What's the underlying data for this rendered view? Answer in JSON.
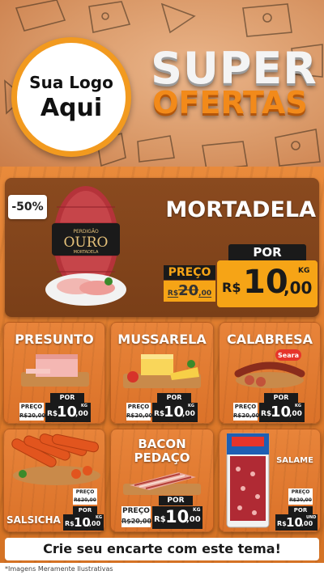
{
  "header": {
    "logo_line1": "Sua Logo",
    "logo_line2": "Aqui",
    "title_line1": "SUPER",
    "title_line2": "OFERTAS"
  },
  "featured": {
    "discount_badge": "-50%",
    "name": "MORTADELA",
    "brand": "OURO",
    "brand_small": "PERDIGÃO",
    "brand_sub": "MORTADELA",
    "preco_label": "PREÇO",
    "old_price_prefix": "R$",
    "old_price": "20",
    "old_price_cents": ",00",
    "por_label": "POR",
    "currency": "R$",
    "price": "10",
    "price_cents": ",00",
    "unit": "KG"
  },
  "products": [
    {
      "name": "PRESUNTO",
      "preco_label": "PREÇO",
      "old_price": "R$20,00",
      "por_label": "POR",
      "currency": "R$",
      "price": "10",
      "price_cents": ",00",
      "unit": "KG"
    },
    {
      "name": "MUSSARELA",
      "preco_label": "PREÇO",
      "old_price": "R$20,00",
      "por_label": "POR",
      "currency": "R$",
      "price": "10",
      "price_cents": ",00",
      "unit": "KG"
    },
    {
      "name": "CALABRESA",
      "brand": "Seara",
      "preco_label": "PREÇO",
      "old_price": "R$20,00",
      "por_label": "POR",
      "currency": "R$",
      "price": "10",
      "price_cents": ",00",
      "unit": "KG"
    },
    {
      "name": "SALSICHA",
      "preco_label": "PREÇO",
      "old_price": "R$20,00",
      "por_label": "POR",
      "currency": "R$",
      "price": "10",
      "price_cents": ",00",
      "unit": "KG"
    },
    {
      "name_line1": "BACON",
      "name_line2": "PEDAÇO",
      "preco_label": "PREÇO",
      "old_price": "R$20,00",
      "por_label": "POR",
      "currency": "R$",
      "price": "10",
      "price_cents": ",00",
      "unit": "KG"
    },
    {
      "name": "SALAME",
      "preco_label": "PREÇO",
      "old_price": "R$20,00",
      "por_label": "POR",
      "currency": "R$",
      "price": "10",
      "price_cents": ",00",
      "unit": "UND"
    }
  ],
  "cta": "Crie seu encarte com este tema!",
  "footer_note": "*Imagens Meramente Ilustrativas",
  "colors": {
    "accent_orange": "#f6a416",
    "wood_orange": "#de7a2c",
    "dark_panel": "#7a3f18",
    "title_orange": "#f28a1a"
  }
}
